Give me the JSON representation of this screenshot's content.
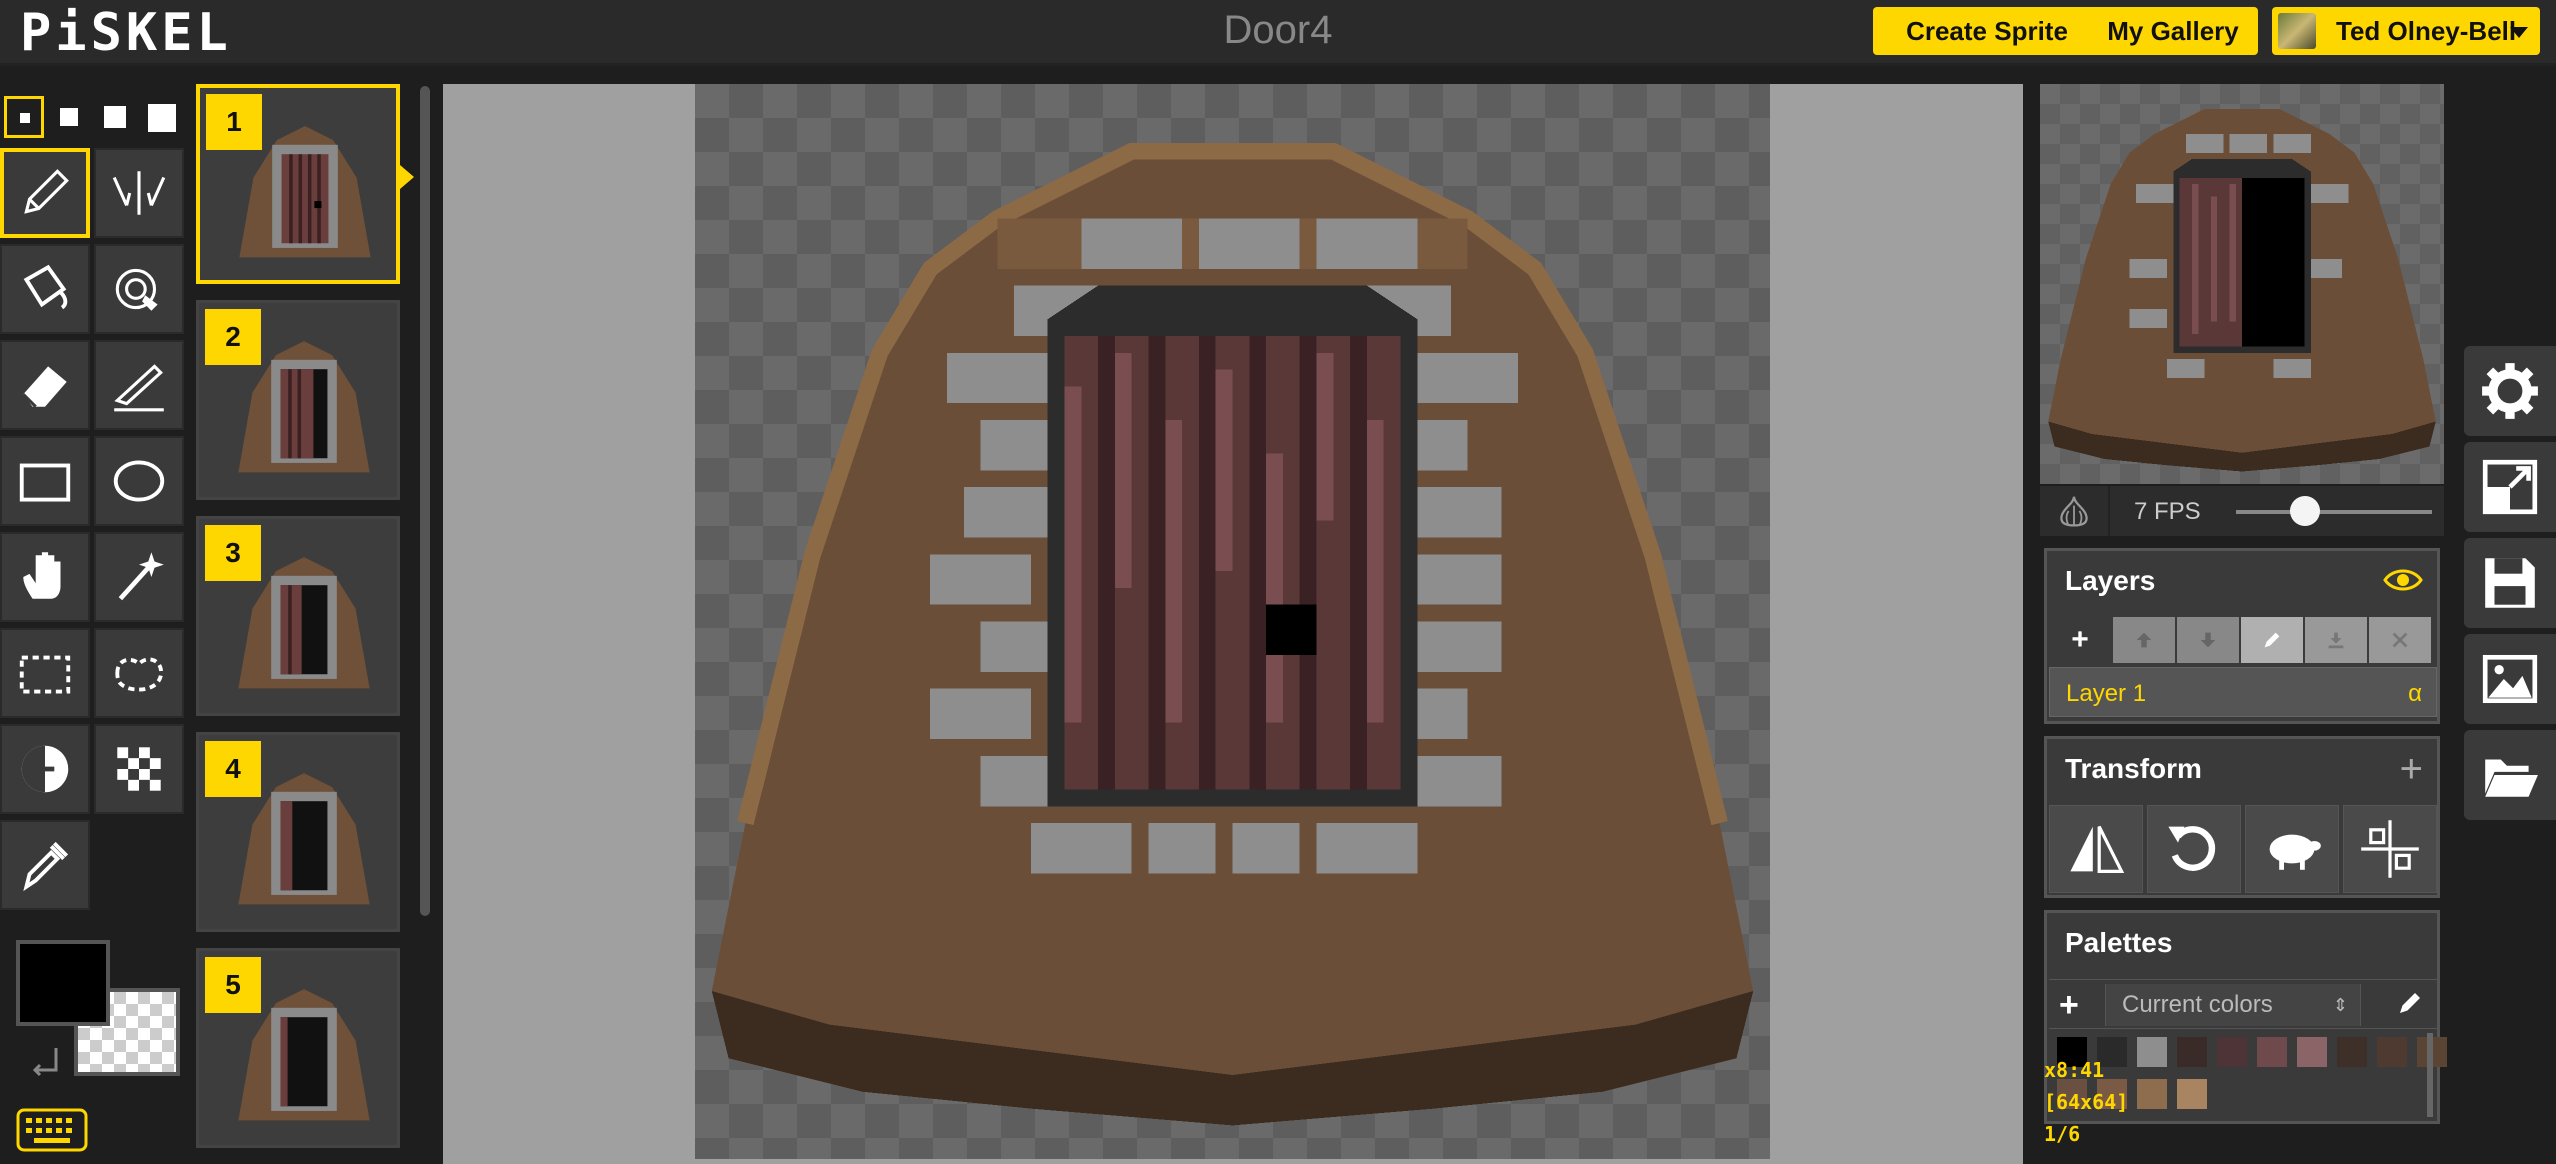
{
  "header": {
    "logo": "PiSKEL",
    "document_title": "Door4",
    "create_sprite_label": "Create Sprite",
    "my_gallery_label": "My Gallery",
    "user_name": "Ted Olney-Bell"
  },
  "tools": {
    "pen_sizes": [
      "pen-size-1",
      "pen-size-2",
      "pen-size-3",
      "pen-size-4"
    ],
    "selected_pen_size": 1,
    "selected_tool": "pen-tool",
    "primary_color": "#000000",
    "secondary_color": "transparent"
  },
  "frames": [
    {
      "number": "1",
      "selected": true
    },
    {
      "number": "2",
      "selected": false
    },
    {
      "number": "3",
      "selected": false
    },
    {
      "number": "4",
      "selected": false
    },
    {
      "number": "5",
      "selected": false
    }
  ],
  "preview": {
    "fps_label": "7 FPS",
    "fps_value": 7
  },
  "layers": {
    "title": "Layers",
    "items": [
      {
        "name": "Layer 1",
        "alpha_label": "α"
      }
    ]
  },
  "transform": {
    "title": "Transform",
    "add_label": "+"
  },
  "palettes": {
    "title": "Palettes",
    "add_label": "+",
    "selected_palette": "Current colors",
    "swatches": [
      "#000000",
      "#2a2a2a",
      "#8e8e8e",
      "#3a2a28",
      "#4e3436",
      "#6e4a4c",
      "#8a6466",
      "#3e3028",
      "#4e3a30",
      "#5a4434",
      "#6a5040",
      "#7a5a44",
      "#8e6c4e",
      "#a88460"
    ]
  },
  "status": {
    "cursor": "x8:41",
    "size": "[64x64]",
    "frame": "1/6"
  },
  "colors": {
    "accent": "#ffd700",
    "panel_bg": "#3a3a3a",
    "app_bg": "#1e1e1e"
  }
}
